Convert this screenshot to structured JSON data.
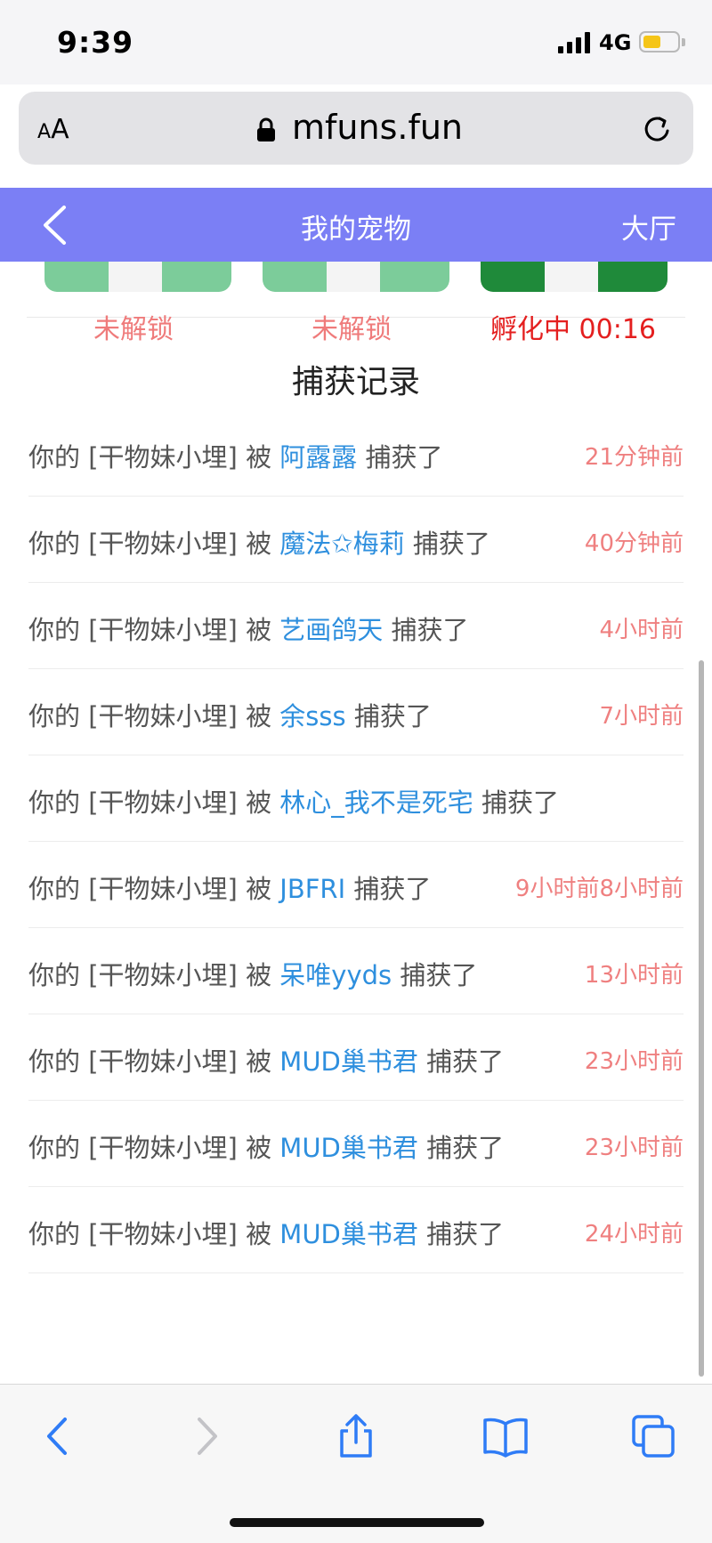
{
  "status": {
    "time": "9:39",
    "network": "4G"
  },
  "browser": {
    "aa": [
      "A",
      "A"
    ],
    "url": "mfuns.fun"
  },
  "header": {
    "title": "我的宠物",
    "right": "大厅"
  },
  "pets": [
    {
      "status": "未解锁",
      "color": "#ef7b7b",
      "body_color": "#7ccc9a"
    },
    {
      "status": "未解锁",
      "color": "#ef7b7b",
      "body_color": "#7ccc9a"
    },
    {
      "status": "孵化中 00:16",
      "color": "#e41f1f",
      "body_color": "#1f8a3a"
    }
  ],
  "section_title": "捕获记录",
  "records": [
    {
      "prefix": "你的 [干物妹小埋] 被",
      "user": "阿露露",
      "suffix": "捕获了",
      "time": "21分钟前"
    },
    {
      "prefix": "你的 [干物妹小埋] 被",
      "user": "魔法✩梅莉",
      "suffix": "捕获了",
      "time": "40分钟前"
    },
    {
      "prefix": "你的 [干物妹小埋] 被",
      "user": "艺画鸽天",
      "suffix": "捕获了",
      "time": "4小时前"
    },
    {
      "prefix": "你的 [干物妹小埋] 被",
      "user": "余sss",
      "suffix": "捕获了",
      "time": "7小时前"
    },
    {
      "prefix": "你的 [干物妹小埋] 被",
      "user": "林心_我不是死宅",
      "suffix": "捕获了",
      "time": ""
    },
    {
      "prefix": "你的 [干物妹小埋] 被",
      "user": "JBFRI",
      "suffix": "捕获了",
      "time": "9小时前8小时前"
    },
    {
      "prefix": "你的 [干物妹小埋] 被",
      "user": "呆唯yyds",
      "suffix": "捕获了",
      "time": "13小时前"
    },
    {
      "prefix": "你的 [干物妹小埋] 被",
      "user": "MUD巢书君",
      "suffix": "捕获了",
      "time": "23小时前"
    },
    {
      "prefix": "你的 [干物妹小埋] 被",
      "user": "MUD巢书君",
      "suffix": "捕获了",
      "time": "23小时前"
    },
    {
      "prefix": "你的 [干物妹小埋] 被",
      "user": "MUD巢书君",
      "suffix": "捕获了",
      "time": "24小时前"
    }
  ],
  "colors": {
    "header_bg": "#7b7ff5",
    "user_link": "#2e8fde",
    "time": "#ef8080",
    "toolbar_icon": "#2f7cf6"
  },
  "toolbar_icons": [
    "back-icon",
    "forward-icon",
    "share-icon",
    "bookmarks-icon",
    "tabs-icon"
  ]
}
